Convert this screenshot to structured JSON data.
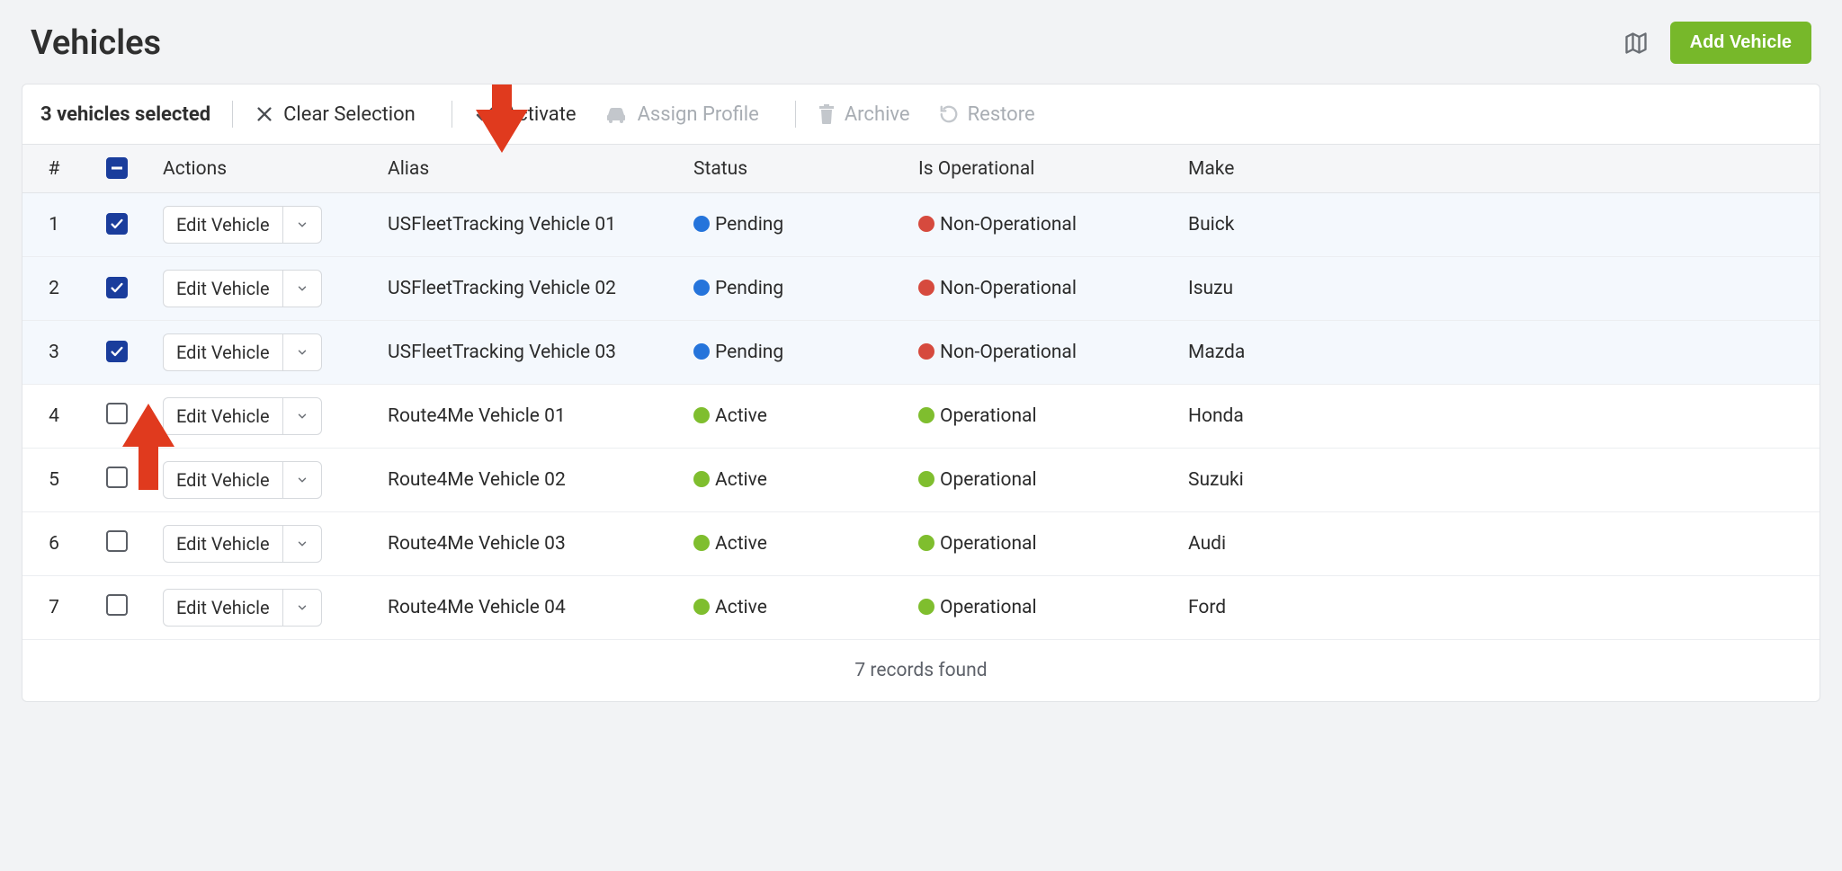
{
  "header": {
    "title": "Vehicles",
    "add_btn": "Add Vehicle"
  },
  "toolbar": {
    "selected_label": "3 vehicles selected",
    "clear": "Clear Selection",
    "activate": "Activate",
    "assign_profile": "Assign Profile",
    "archive": "Archive",
    "restore": "Restore"
  },
  "table": {
    "headers": {
      "num": "#",
      "actions": "Actions",
      "alias": "Alias",
      "status": "Status",
      "operational": "Is Operational",
      "make": "Make"
    },
    "edit_label": "Edit Vehicle",
    "rows": [
      {
        "num": "1",
        "selected": true,
        "alias": "USFleetTracking Vehicle 01",
        "status_dot": "blue",
        "status": "Pending",
        "oper_dot": "red",
        "oper": "Non-Operational",
        "make": "Buick"
      },
      {
        "num": "2",
        "selected": true,
        "alias": "USFleetTracking Vehicle 02",
        "status_dot": "blue",
        "status": "Pending",
        "oper_dot": "red",
        "oper": "Non-Operational",
        "make": "Isuzu"
      },
      {
        "num": "3",
        "selected": true,
        "alias": "USFleetTracking Vehicle 03",
        "status_dot": "blue",
        "status": "Pending",
        "oper_dot": "red",
        "oper": "Non-Operational",
        "make": "Mazda"
      },
      {
        "num": "4",
        "selected": false,
        "alias": "Route4Me Vehicle 01",
        "status_dot": "green",
        "status": "Active",
        "oper_dot": "green",
        "oper": "Operational",
        "make": "Honda"
      },
      {
        "num": "5",
        "selected": false,
        "alias": "Route4Me Vehicle 02",
        "status_dot": "green",
        "status": "Active",
        "oper_dot": "green",
        "oper": "Operational",
        "make": "Suzuki"
      },
      {
        "num": "6",
        "selected": false,
        "alias": "Route4Me Vehicle 03",
        "status_dot": "green",
        "status": "Active",
        "oper_dot": "green",
        "oper": "Operational",
        "make": "Audi"
      },
      {
        "num": "7",
        "selected": false,
        "alias": "Route4Me Vehicle 04",
        "status_dot": "green",
        "status": "Active",
        "oper_dot": "green",
        "oper": "Operational",
        "make": "Ford"
      }
    ],
    "footer": "7 records found"
  }
}
